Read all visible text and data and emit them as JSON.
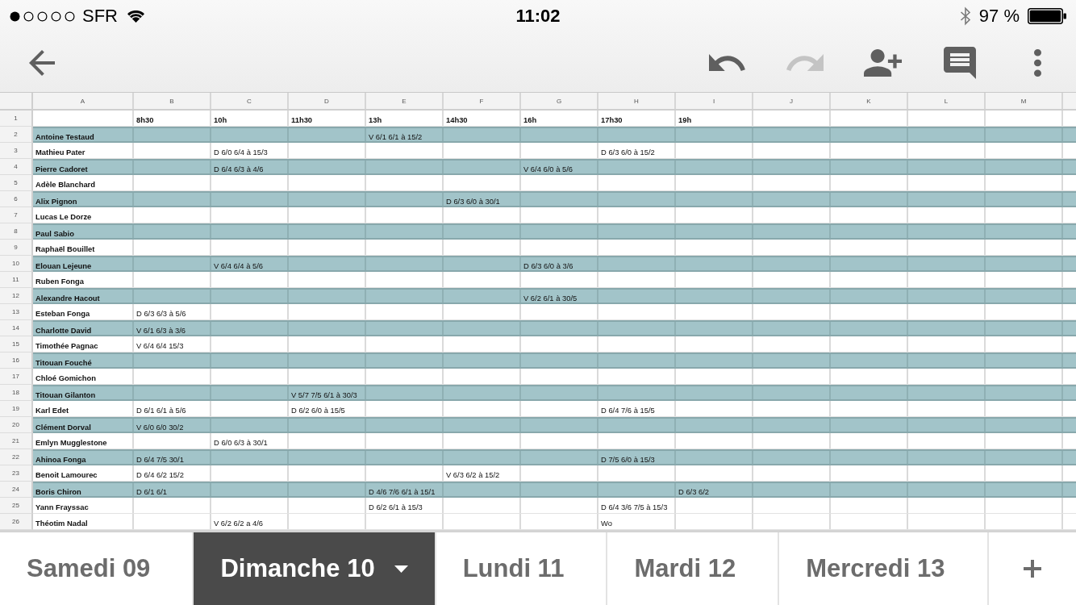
{
  "status_bar": {
    "carrier": "SFR",
    "time": "11:02",
    "battery": "97 %"
  },
  "toolbar": {
    "buttons": [
      {
        "kind": "back",
        "disabled": false
      },
      {
        "kind": "undo",
        "disabled": false
      },
      {
        "kind": "redo",
        "disabled": true
      },
      {
        "kind": "add_person",
        "disabled": false
      },
      {
        "kind": "comments",
        "disabled": false
      },
      {
        "kind": "more",
        "disabled": false
      }
    ]
  },
  "sheet": {
    "columns": [
      "A",
      "B",
      "C",
      "D",
      "E",
      "F",
      "G",
      "H",
      "I",
      "J",
      "K",
      "L",
      "M"
    ],
    "rows": [
      {
        "number": "1",
        "kind": "header",
        "highlighted": false,
        "cells": [
          null,
          "8h30",
          "10h",
          "11h30",
          "13h",
          "14h30",
          "16h",
          "17h30",
          "19h"
        ]
      },
      {
        "number": "2",
        "kind": "entry",
        "highlighted": true,
        "cells": [
          "Antoine Testaud",
          null,
          null,
          null,
          "V 6/1 6/1 à 15/2"
        ]
      },
      {
        "number": "3",
        "kind": "entry",
        "highlighted": false,
        "cells": [
          "Mathieu Pater",
          null,
          "D 6/0 6/4 à 15/3",
          null,
          null,
          null,
          null,
          "D 6/3 6/0 à 15/2"
        ]
      },
      {
        "number": "4",
        "kind": "entry",
        "highlighted": true,
        "cells": [
          "Pierre Cadoret",
          null,
          "D 6/4 6/3 à 4/6",
          null,
          null,
          null,
          "V 6/4 6/0 à 5/6"
        ]
      },
      {
        "number": "5",
        "kind": "entry",
        "highlighted": false,
        "cells": [
          "Adèle Blanchard"
        ]
      },
      {
        "number": "6",
        "kind": "entry",
        "highlighted": true,
        "cells": [
          "Alix Pignon",
          null,
          null,
          null,
          null,
          "D 6/3 6/0 à 30/1"
        ]
      },
      {
        "number": "7",
        "kind": "entry",
        "highlighted": false,
        "cells": [
          "Lucas Le Dorze"
        ]
      },
      {
        "number": "8",
        "kind": "entry",
        "highlighted": true,
        "cells": [
          "Paul Sabio"
        ]
      },
      {
        "number": "9",
        "kind": "entry",
        "highlighted": false,
        "cells": [
          "Raphaël Bouillet"
        ]
      },
      {
        "number": "10",
        "kind": "entry",
        "highlighted": true,
        "cells": [
          "Elouan Lejeune",
          null,
          "V 6/4 6/4 à 5/6",
          null,
          null,
          null,
          "D 6/3 6/0 à 3/6"
        ]
      },
      {
        "number": "11",
        "kind": "entry",
        "highlighted": false,
        "cells": [
          "Ruben Fonga"
        ]
      },
      {
        "number": "12",
        "kind": "entry",
        "highlighted": true,
        "cells": [
          "Alexandre Hacout",
          null,
          null,
          null,
          null,
          null,
          "V 6/2 6/1 à 30/5"
        ]
      },
      {
        "number": "13",
        "kind": "entry",
        "highlighted": false,
        "cells": [
          "Esteban Fonga",
          "D 6/3 6/3 à 5/6"
        ]
      },
      {
        "number": "14",
        "kind": "entry",
        "highlighted": true,
        "cells": [
          "Charlotte David",
          "V 6/1 6/3 à 3/6"
        ]
      },
      {
        "number": "15",
        "kind": "entry",
        "highlighted": false,
        "cells": [
          "Timothée Pagnac",
          "V 6/4 6/4 15/3"
        ]
      },
      {
        "number": "16",
        "kind": "entry",
        "highlighted": true,
        "cells": [
          "Titouan Fouché"
        ]
      },
      {
        "number": "17",
        "kind": "entry",
        "highlighted": false,
        "cells": [
          "Chloé Gomichon"
        ]
      },
      {
        "number": "18",
        "kind": "entry",
        "highlighted": true,
        "cells": [
          "Titouan Gilanton",
          null,
          null,
          "V 5/7 7/5 6/1 à 30/3"
        ]
      },
      {
        "number": "19",
        "kind": "entry",
        "highlighted": false,
        "cells": [
          "Karl Edet",
          "D 6/1 6/1 à 5/6",
          null,
          "D 6/2 6/0 à 15/5",
          null,
          null,
          null,
          "D 6/4 7/6 à 15/5"
        ]
      },
      {
        "number": "20",
        "kind": "entry",
        "highlighted": true,
        "cells": [
          "Clément Dorval",
          "V 6/0 6/0 30/2"
        ]
      },
      {
        "number": "21",
        "kind": "entry",
        "highlighted": false,
        "cells": [
          "Emlyn Mugglestone",
          null,
          "D 6/0 6/3 à 30/1"
        ]
      },
      {
        "number": "22",
        "kind": "entry",
        "highlighted": true,
        "cells": [
          "Ahinoa Fonga",
          "D 6/4 7/5 30/1",
          null,
          null,
          null,
          null,
          null,
          "D 7/5 6/0 à 15/3"
        ]
      },
      {
        "number": "23",
        "kind": "entry",
        "highlighted": false,
        "cells": [
          "Benoit Lamourec",
          "D 6/4 6/2 15/2",
          null,
          null,
          null,
          "V 6/3 6/2 à 15/2"
        ]
      },
      {
        "number": "24",
        "kind": "entry",
        "highlighted": true,
        "cells": [
          "Boris Chiron",
          "D 6/1 6/1",
          null,
          null,
          "D 4/6 7/6 6/1 à 15/1",
          null,
          null,
          null,
          "D 6/3 6/2"
        ]
      },
      {
        "number": "25",
        "kind": "entry",
        "highlighted": false,
        "cells": [
          "Yann Frayssac",
          null,
          null,
          null,
          "D 6/2 6/1 à 15/3",
          null,
          null,
          "D 6/4 3/6 7/5 à 15/3"
        ]
      },
      {
        "number": "26",
        "kind": "entry",
        "highlighted": false,
        "cells": [
          "Théotim Nadal",
          null,
          "V 6/2 6/2 a 4/6",
          null,
          null,
          null,
          null,
          "Wo"
        ]
      }
    ]
  },
  "tabs": [
    {
      "label": "Samedi 09",
      "selected": false
    },
    {
      "label": "Dimanche 10",
      "selected": true
    },
    {
      "label": "Lundi 11",
      "selected": false
    },
    {
      "label": "Mardi 12",
      "selected": false
    },
    {
      "label": "Mercredi 13",
      "selected": false
    }
  ]
}
